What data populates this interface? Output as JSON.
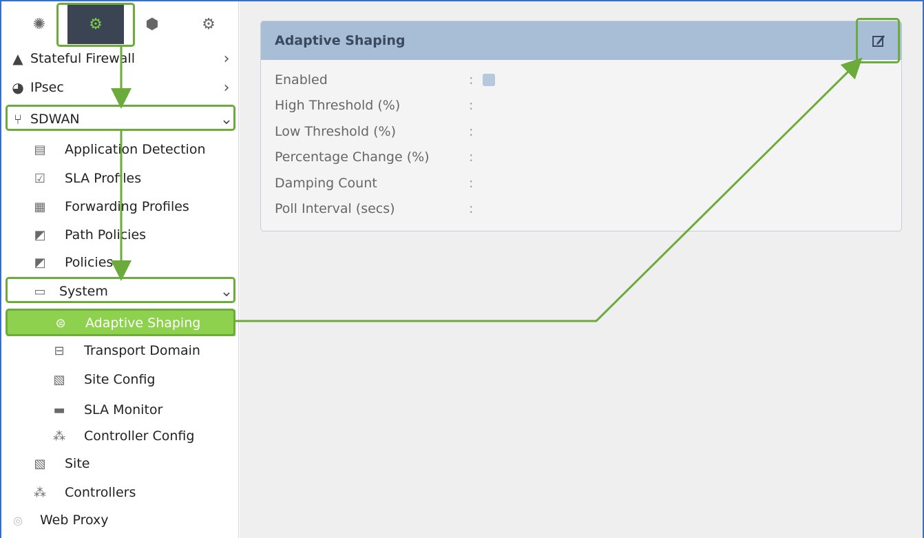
{
  "tabs": [
    {
      "name": "network-icon",
      "glyph": "✺"
    },
    {
      "name": "gear-icon",
      "glyph": "⚙"
    },
    {
      "name": "cube-icon",
      "glyph": "⬢"
    },
    {
      "name": "globe-settings-icon",
      "glyph": "⚙"
    }
  ],
  "nav": {
    "stateful_firewall": "Stateful Firewall",
    "ipsec": "IPsec",
    "sdwan": "SDWAN",
    "application_detection": "Application Detection",
    "sla_profiles": "SLA Profiles",
    "forwarding_profiles": "Forwarding Profiles",
    "path_policies": "Path Policies",
    "policies": "Policies",
    "system": "System",
    "adaptive_shaping": "Adaptive Shaping",
    "transport_domain": "Transport Domain",
    "site_config": "Site Config",
    "sla_monitor": "SLA Monitor",
    "controller_config": "Controller Config",
    "site": "Site",
    "controllers": "Controllers",
    "web_proxy": "Web Proxy"
  },
  "panel": {
    "title": "Adaptive Shaping",
    "separator": ":",
    "fields": [
      {
        "label": "Enabled",
        "value": ""
      },
      {
        "label": "High Threshold (%)",
        "value": ""
      },
      {
        "label": "Low Threshold (%)",
        "value": ""
      },
      {
        "label": "Percentage Change (%)",
        "value": ""
      },
      {
        "label": "Damping Count",
        "value": ""
      },
      {
        "label": "Poll Interval (secs)",
        "value": ""
      }
    ]
  },
  "colors": {
    "accent_green": "#8ed14f",
    "highlight_green": "#6aab3c",
    "panel_header": "#a8bed6",
    "tab_active": "#3a4452"
  }
}
